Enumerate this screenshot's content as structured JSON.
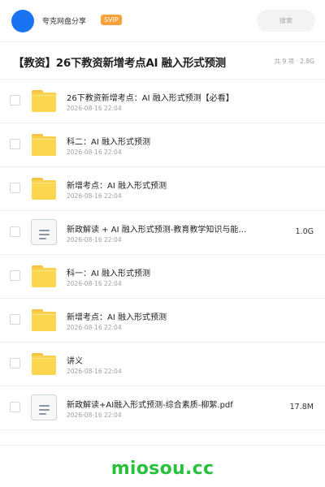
{
  "header": {
    "brand": "夸克网盘分享",
    "badge": "SVIP",
    "search_placeholder": "搜索",
    "avatar_color": "#1a73f0"
  },
  "title_row": {
    "title": "【教资】26下教资新增考点AI 融入形式预测",
    "meta": "共 9 项 · 2.8G"
  },
  "files": [
    {
      "type": "folder",
      "name": "26下教资新增考点：AI 融入形式预测【必看】",
      "date": "2026-08-16 22:04",
      "size": ""
    },
    {
      "type": "folder",
      "name": "科二：AI 融入形式预测",
      "date": "2026-08-16 22:04",
      "size": ""
    },
    {
      "type": "folder",
      "name": "新增考点：AI 融入形式预测",
      "date": "2026-08-16 22:04",
      "size": ""
    },
    {
      "type": "file",
      "name": "新政解读 + AI 融入形式预测-教育教学知识与能…",
      "date": "2026-08-16 22:04",
      "size": "1.0G"
    },
    {
      "type": "folder",
      "name": "科一：AI 融入形式预测",
      "date": "2026-08-16 22:04",
      "size": ""
    },
    {
      "type": "folder",
      "name": "新增考点：AI 融入形式预测",
      "date": "2026-08-16 22:04",
      "size": ""
    },
    {
      "type": "folder",
      "name": "讲义",
      "date": "2026-08-16 22:04",
      "size": ""
    },
    {
      "type": "file",
      "name": "新政解读+AI融入形式预测-综合素质-柳絮.pdf",
      "date": "2026-08-16 22:04",
      "size": "17.8M"
    }
  ],
  "footer": {
    "watermark": "miosou.cc",
    "watermark_color": "#28c13c"
  }
}
